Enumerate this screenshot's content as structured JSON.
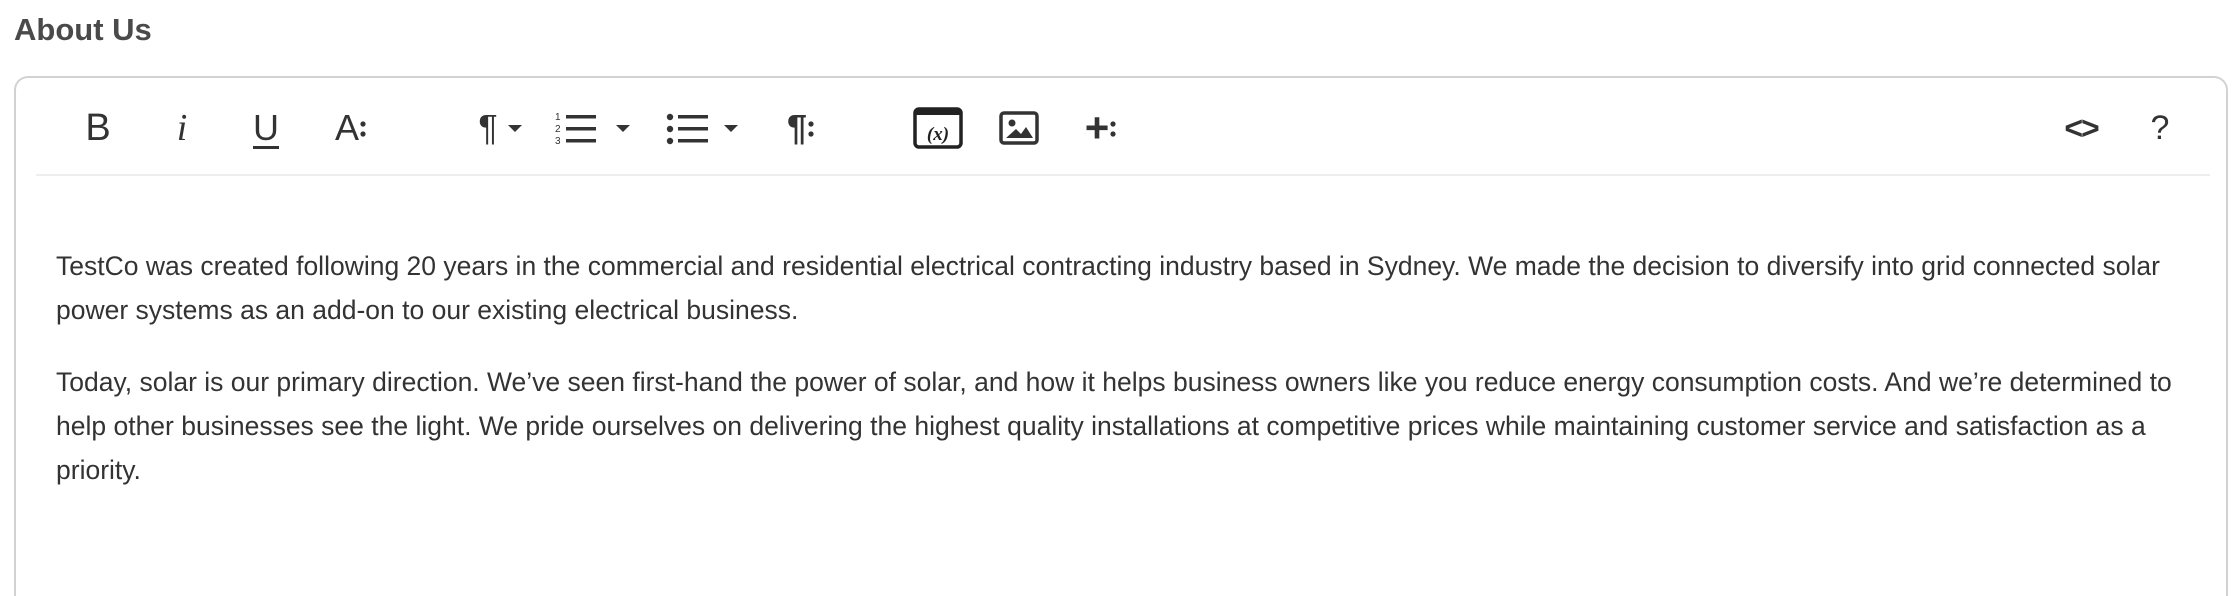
{
  "field": {
    "label": "About Us"
  },
  "toolbar": {
    "buttons": [
      {
        "name": "bold-button",
        "icon": "bold-icon",
        "glyph": "B"
      },
      {
        "name": "italic-button",
        "icon": "italic-icon",
        "glyph": "i"
      },
      {
        "name": "underline-button",
        "icon": "underline-icon",
        "glyph": "U"
      },
      {
        "name": "text-style-button",
        "icon": "font-size-icon",
        "glyph": "A"
      },
      {
        "name": "paragraph-format-button",
        "icon": "paragraph-icon",
        "glyph": "¶"
      },
      {
        "name": "ordered-list-button",
        "icon": "ordered-list-icon"
      },
      {
        "name": "unordered-list-button",
        "icon": "unordered-list-icon"
      },
      {
        "name": "paragraph-more-button",
        "icon": "paragraph-more-icon",
        "glyph": "¶"
      },
      {
        "name": "insert-variable-button",
        "icon": "variable-icon",
        "glyph": "(x)"
      },
      {
        "name": "insert-image-button",
        "icon": "image-icon"
      },
      {
        "name": "insert-more-button",
        "icon": "plus-more-icon",
        "glyph": "+"
      },
      {
        "name": "code-view-button",
        "icon": "code-icon",
        "glyph": "<>"
      },
      {
        "name": "help-button",
        "icon": "help-icon",
        "glyph": "?"
      }
    ]
  },
  "content": {
    "paragraphs": [
      "TestCo was created following 20 years in the commercial and residential electrical contracting industry based in Sydney. We made the decision to diversify into grid connected solar power systems as an add-on to our existing electrical business.",
      "Today, solar is our primary direction. We’ve seen first-hand the power of solar, and how it helps business owners like you reduce energy consumption costs. And we’re determined to help other businesses see the light. We pride ourselves on delivering the highest quality installations at competitive prices while maintaining customer service and satisfaction as a priority."
    ]
  }
}
